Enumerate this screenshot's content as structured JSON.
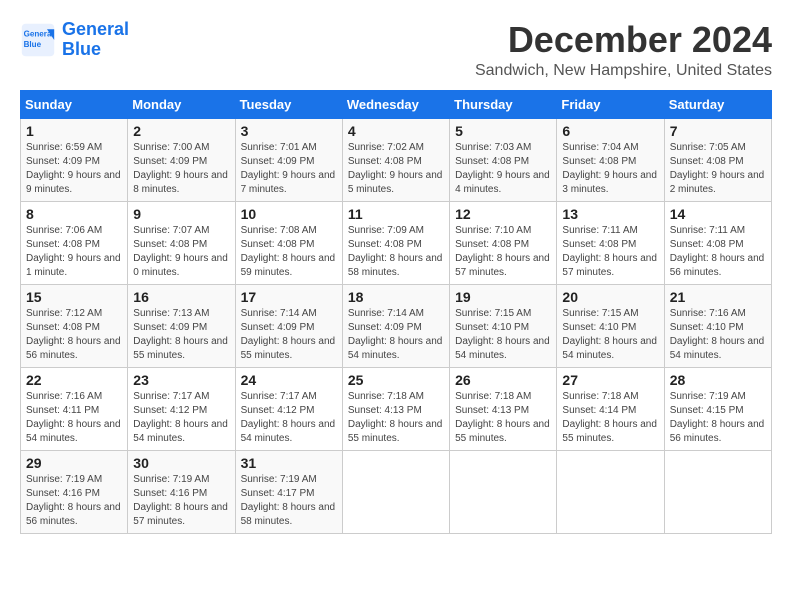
{
  "header": {
    "logo_line1": "General",
    "logo_line2": "Blue",
    "month_title": "December 2024",
    "subtitle": "Sandwich, New Hampshire, United States"
  },
  "weekdays": [
    "Sunday",
    "Monday",
    "Tuesday",
    "Wednesday",
    "Thursday",
    "Friday",
    "Saturday"
  ],
  "weeks": [
    [
      {
        "day": "1",
        "info": "Sunrise: 6:59 AM\nSunset: 4:09 PM\nDaylight: 9 hours and 9 minutes."
      },
      {
        "day": "2",
        "info": "Sunrise: 7:00 AM\nSunset: 4:09 PM\nDaylight: 9 hours and 8 minutes."
      },
      {
        "day": "3",
        "info": "Sunrise: 7:01 AM\nSunset: 4:09 PM\nDaylight: 9 hours and 7 minutes."
      },
      {
        "day": "4",
        "info": "Sunrise: 7:02 AM\nSunset: 4:08 PM\nDaylight: 9 hours and 5 minutes."
      },
      {
        "day": "5",
        "info": "Sunrise: 7:03 AM\nSunset: 4:08 PM\nDaylight: 9 hours and 4 minutes."
      },
      {
        "day": "6",
        "info": "Sunrise: 7:04 AM\nSunset: 4:08 PM\nDaylight: 9 hours and 3 minutes."
      },
      {
        "day": "7",
        "info": "Sunrise: 7:05 AM\nSunset: 4:08 PM\nDaylight: 9 hours and 2 minutes."
      }
    ],
    [
      {
        "day": "8",
        "info": "Sunrise: 7:06 AM\nSunset: 4:08 PM\nDaylight: 9 hours and 1 minute."
      },
      {
        "day": "9",
        "info": "Sunrise: 7:07 AM\nSunset: 4:08 PM\nDaylight: 9 hours and 0 minutes."
      },
      {
        "day": "10",
        "info": "Sunrise: 7:08 AM\nSunset: 4:08 PM\nDaylight: 8 hours and 59 minutes."
      },
      {
        "day": "11",
        "info": "Sunrise: 7:09 AM\nSunset: 4:08 PM\nDaylight: 8 hours and 58 minutes."
      },
      {
        "day": "12",
        "info": "Sunrise: 7:10 AM\nSunset: 4:08 PM\nDaylight: 8 hours and 57 minutes."
      },
      {
        "day": "13",
        "info": "Sunrise: 7:11 AM\nSunset: 4:08 PM\nDaylight: 8 hours and 57 minutes."
      },
      {
        "day": "14",
        "info": "Sunrise: 7:11 AM\nSunset: 4:08 PM\nDaylight: 8 hours and 56 minutes."
      }
    ],
    [
      {
        "day": "15",
        "info": "Sunrise: 7:12 AM\nSunset: 4:08 PM\nDaylight: 8 hours and 56 minutes."
      },
      {
        "day": "16",
        "info": "Sunrise: 7:13 AM\nSunset: 4:09 PM\nDaylight: 8 hours and 55 minutes."
      },
      {
        "day": "17",
        "info": "Sunrise: 7:14 AM\nSunset: 4:09 PM\nDaylight: 8 hours and 55 minutes."
      },
      {
        "day": "18",
        "info": "Sunrise: 7:14 AM\nSunset: 4:09 PM\nDaylight: 8 hours and 54 minutes."
      },
      {
        "day": "19",
        "info": "Sunrise: 7:15 AM\nSunset: 4:10 PM\nDaylight: 8 hours and 54 minutes."
      },
      {
        "day": "20",
        "info": "Sunrise: 7:15 AM\nSunset: 4:10 PM\nDaylight: 8 hours and 54 minutes."
      },
      {
        "day": "21",
        "info": "Sunrise: 7:16 AM\nSunset: 4:10 PM\nDaylight: 8 hours and 54 minutes."
      }
    ],
    [
      {
        "day": "22",
        "info": "Sunrise: 7:16 AM\nSunset: 4:11 PM\nDaylight: 8 hours and 54 minutes."
      },
      {
        "day": "23",
        "info": "Sunrise: 7:17 AM\nSunset: 4:12 PM\nDaylight: 8 hours and 54 minutes."
      },
      {
        "day": "24",
        "info": "Sunrise: 7:17 AM\nSunset: 4:12 PM\nDaylight: 8 hours and 54 minutes."
      },
      {
        "day": "25",
        "info": "Sunrise: 7:18 AM\nSunset: 4:13 PM\nDaylight: 8 hours and 55 minutes."
      },
      {
        "day": "26",
        "info": "Sunrise: 7:18 AM\nSunset: 4:13 PM\nDaylight: 8 hours and 55 minutes."
      },
      {
        "day": "27",
        "info": "Sunrise: 7:18 AM\nSunset: 4:14 PM\nDaylight: 8 hours and 55 minutes."
      },
      {
        "day": "28",
        "info": "Sunrise: 7:19 AM\nSunset: 4:15 PM\nDaylight: 8 hours and 56 minutes."
      }
    ],
    [
      {
        "day": "29",
        "info": "Sunrise: 7:19 AM\nSunset: 4:16 PM\nDaylight: 8 hours and 56 minutes."
      },
      {
        "day": "30",
        "info": "Sunrise: 7:19 AM\nSunset: 4:16 PM\nDaylight: 8 hours and 57 minutes."
      },
      {
        "day": "31",
        "info": "Sunrise: 7:19 AM\nSunset: 4:17 PM\nDaylight: 8 hours and 58 minutes."
      },
      null,
      null,
      null,
      null
    ]
  ]
}
